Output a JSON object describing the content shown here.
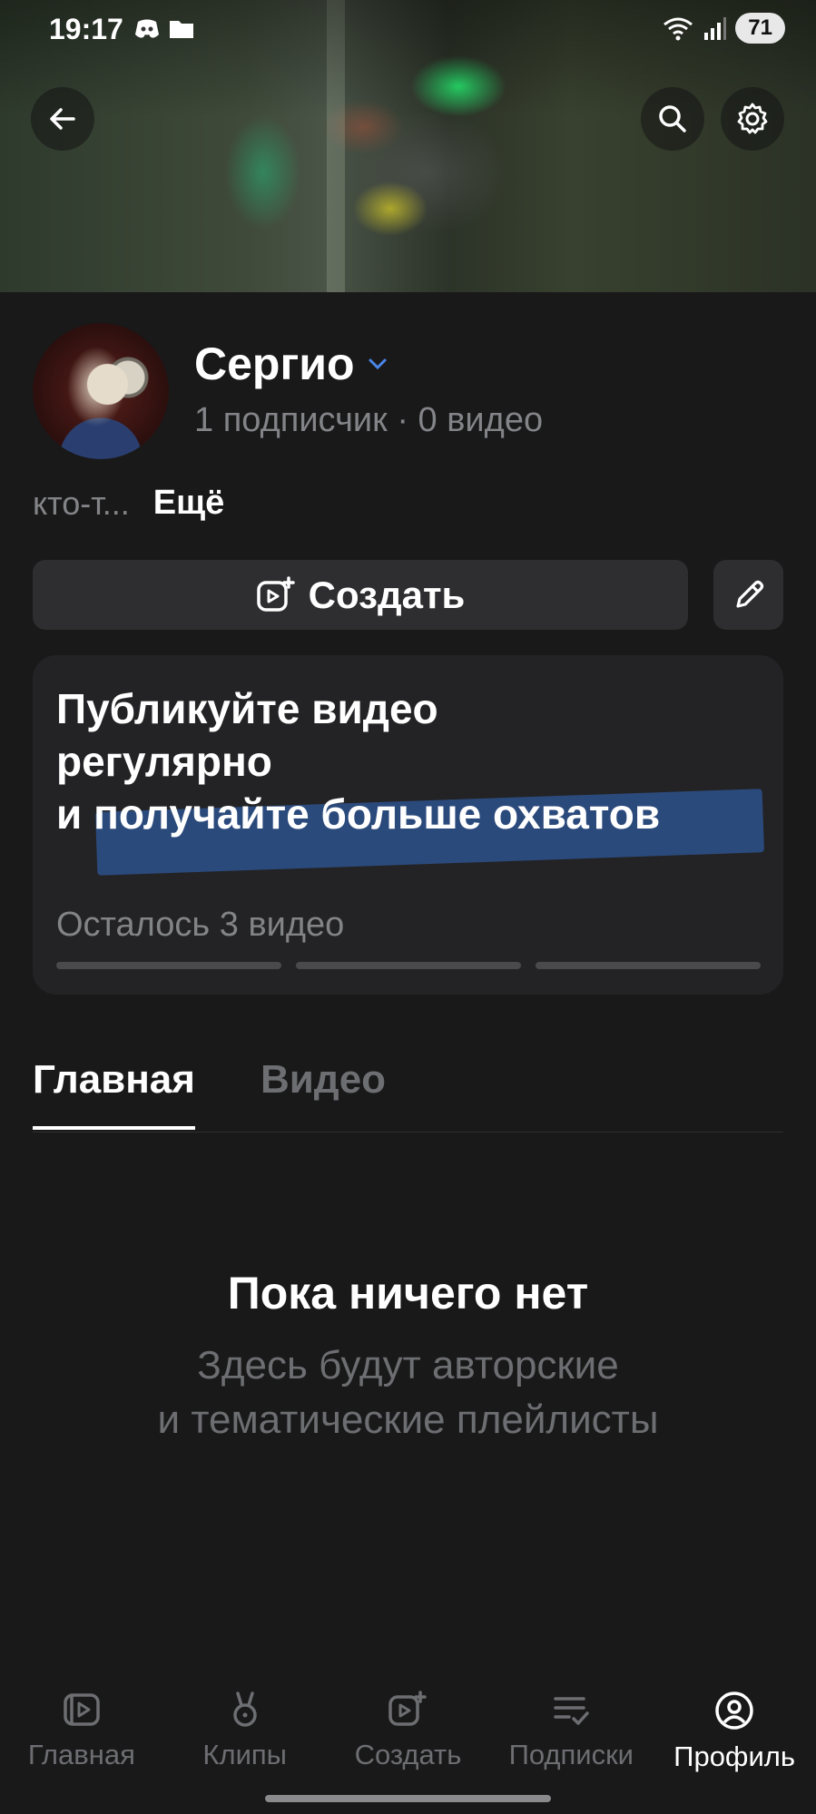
{
  "status_bar": {
    "time": "19:17",
    "battery": "71"
  },
  "profile": {
    "name": "Сергио",
    "stats": "1 подписчик · 0 видео",
    "description": "кто-т...",
    "more_label": "Ещё"
  },
  "actions": {
    "create_label": "Создать"
  },
  "promo": {
    "title_line1": "Публикуйте видео",
    "title_line2": "регулярно",
    "title_line3_prefix": "и",
    "title_highlight": "получайте больше охватов",
    "remaining": "Осталось 3 видео",
    "progress_segments": 3,
    "progress_filled": 0
  },
  "tabs": [
    {
      "label": "Главная",
      "active": true
    },
    {
      "label": "Видео",
      "active": false
    }
  ],
  "empty_state": {
    "title": "Пока ничего нет",
    "line1": "Здесь будут авторские",
    "line2": "и тематические плейлисты"
  },
  "bottom_nav": [
    {
      "label": "Главная",
      "icon": "video-library-icon",
      "active": false
    },
    {
      "label": "Клипы",
      "icon": "clips-icon",
      "active": false
    },
    {
      "label": "Создать",
      "icon": "create-video-icon",
      "active": false
    },
    {
      "label": "Подписки",
      "icon": "subscriptions-icon",
      "active": false
    },
    {
      "label": "Профиль",
      "icon": "profile-icon",
      "active": true
    }
  ],
  "colors": {
    "background": "#19191a",
    "card": "#232325",
    "button": "#2e2e30",
    "muted_text": "#838487",
    "highlight": "#2b4a7c",
    "accent_chevron": "#4a86e8"
  }
}
